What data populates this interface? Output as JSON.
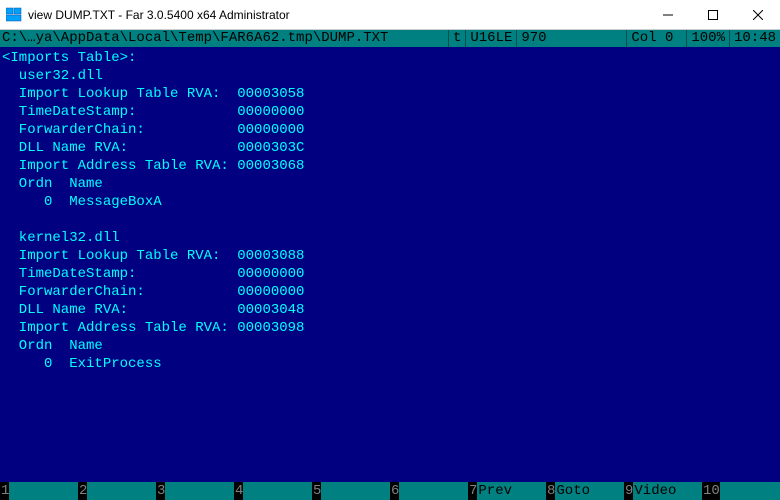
{
  "window": {
    "title": "view DUMP.TXT - Far 3.0.5400 x64 Administrator"
  },
  "status": {
    "path": "C:\\…ya\\AppData\\Local\\Temp\\FAR6A62.tmp\\DUMP.TXT",
    "mode": "t",
    "encoding": "U16LE",
    "size": "970",
    "col": "Col 0",
    "pct": "100%",
    "time": "10:48"
  },
  "content": {
    "header": "<Imports Table>:",
    "modules": [
      {
        "name": "user32.dll",
        "fields": {
          "lookup_rva_label": "Import Lookup Table RVA:",
          "lookup_rva": "00003058",
          "timedate_label": "TimeDateStamp:",
          "timedate": "00000000",
          "forwarder_label": "ForwarderChain:",
          "forwarder": "00000000",
          "dllname_label": "DLL Name RVA:",
          "dllname": "0000303C",
          "iat_label": "Import Address Table RVA:",
          "iat": "00003068"
        },
        "ordn_header": "Ordn",
        "name_header": "Name",
        "entries": [
          {
            "ordn": "0",
            "name": "MessageBoxA"
          }
        ]
      },
      {
        "name": "kernel32.dll",
        "fields": {
          "lookup_rva_label": "Import Lookup Table RVA:",
          "lookup_rva": "00003088",
          "timedate_label": "TimeDateStamp:",
          "timedate": "00000000",
          "forwarder_label": "ForwarderChain:",
          "forwarder": "00000000",
          "dllname_label": "DLL Name RVA:",
          "dllname": "00003048",
          "iat_label": "Import Address Table RVA:",
          "iat": "00003098"
        },
        "ordn_header": "Ordn",
        "name_header": "Name",
        "entries": [
          {
            "ordn": "0",
            "name": "ExitProcess"
          }
        ]
      }
    ]
  },
  "keybar": [
    {
      "num": "1",
      "label": ""
    },
    {
      "num": "2",
      "label": ""
    },
    {
      "num": "3",
      "label": ""
    },
    {
      "num": "4",
      "label": ""
    },
    {
      "num": "5",
      "label": ""
    },
    {
      "num": "6",
      "label": ""
    },
    {
      "num": "7",
      "label": "Prev"
    },
    {
      "num": "8",
      "label": "Goto"
    },
    {
      "num": "9",
      "label": "Video"
    },
    {
      "num": "10",
      "label": ""
    }
  ]
}
